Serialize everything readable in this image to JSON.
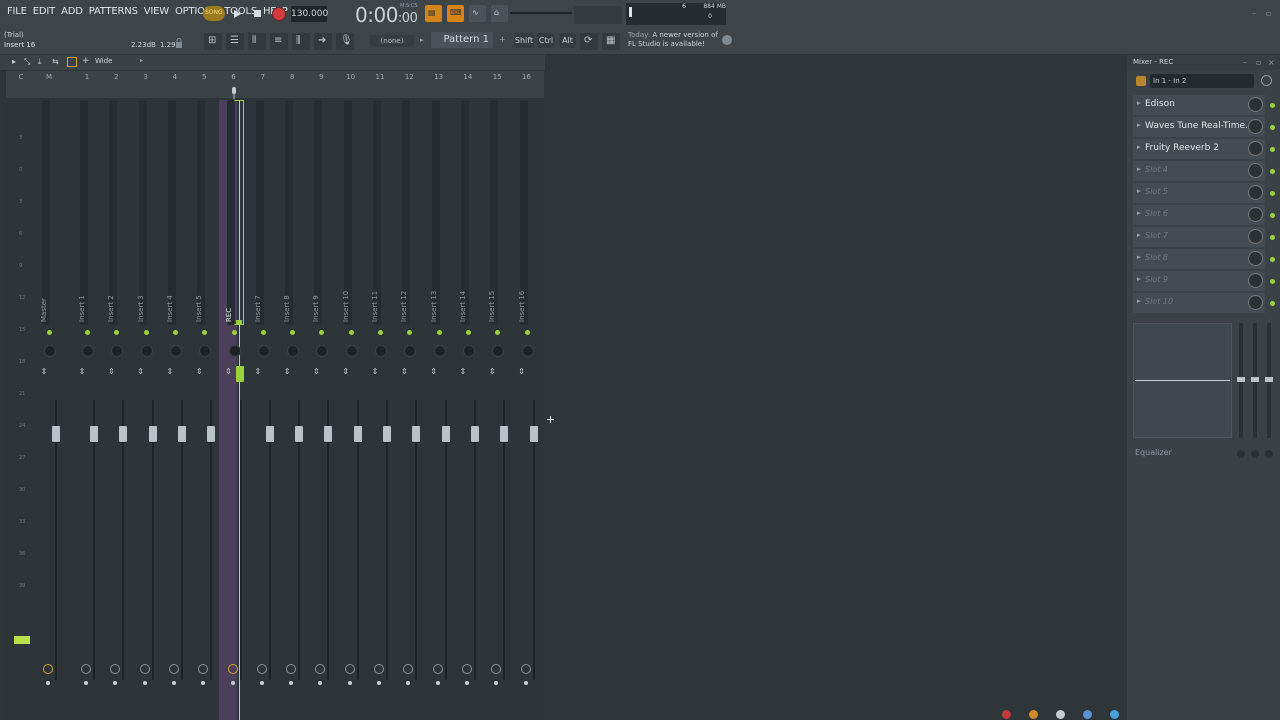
{
  "menu": [
    "FILE",
    "EDIT",
    "ADD",
    "PATTERNS",
    "VIEW",
    "OPTIONS",
    "TOOLS",
    "HELP"
  ],
  "transport": {
    "song_label": "SONG",
    "tempo": "130.000",
    "time": "0:00",
    "time_sub": ":00",
    "time_format": "M:S:CS"
  },
  "cpu": {
    "polyphony": "6",
    "memory": "884 MB",
    "zero": "0"
  },
  "hint": {
    "trial": "(Trial)",
    "insert": "Insert 16",
    "db": "2.23dB",
    "ratio": "1.29"
  },
  "toolbar": {
    "channel_selector": "(none)",
    "pattern": "Pattern 1",
    "shift": "Shift",
    "ctrl": "Ctrl",
    "alt": "Alt"
  },
  "news": {
    "prefix": "Today:",
    "line1": "A newer version of",
    "line2": "FL Studio is available!"
  },
  "mixer": {
    "view_mode": "Wide",
    "ruler_left": [
      "C",
      "M"
    ],
    "track_numbers": [
      "1",
      "2",
      "3",
      "4",
      "5",
      "6",
      "7",
      "8",
      "9",
      "10",
      "11",
      "12",
      "13",
      "14",
      "15",
      "16"
    ],
    "track_names": [
      "Master",
      "Insert 1",
      "Insert 2",
      "Insert 3",
      "Insert 4",
      "Insert 5",
      "REC",
      "Insert 7",
      "Insert 8",
      "Insert 9",
      "Insert 10",
      "Insert 11",
      "Insert 12",
      "Insert 13",
      "Insert 14",
      "Insert 15",
      "Insert 16"
    ],
    "db_scale": [
      "3",
      "0",
      "3",
      "6",
      "9",
      "12",
      "15",
      "18",
      "21",
      "24",
      "27",
      "30",
      "33",
      "36",
      "39"
    ]
  },
  "insert_panel": {
    "title": "Mixer - REC",
    "input": "In 1 - In 2",
    "slots": [
      {
        "label": "Edison",
        "empty": false
      },
      {
        "label": "Waves Tune Real-Time...",
        "empty": false
      },
      {
        "label": "Fruity Reeverb 2",
        "empty": false
      },
      {
        "label": "Slot 4",
        "empty": true
      },
      {
        "label": "Slot 5",
        "empty": true
      },
      {
        "label": "Slot 6",
        "empty": true
      },
      {
        "label": "Slot 7",
        "empty": true
      },
      {
        "label": "Slot 8",
        "empty": true
      },
      {
        "label": "Slot 9",
        "empty": true
      },
      {
        "label": "Slot 10",
        "empty": true
      }
    ],
    "eq_label": "Equalizer"
  },
  "colors": {
    "accent_green": "#9ad23b",
    "accent_orange": "#d58419",
    "record_red": "#d23c3c",
    "selected_track": "#50405e"
  }
}
